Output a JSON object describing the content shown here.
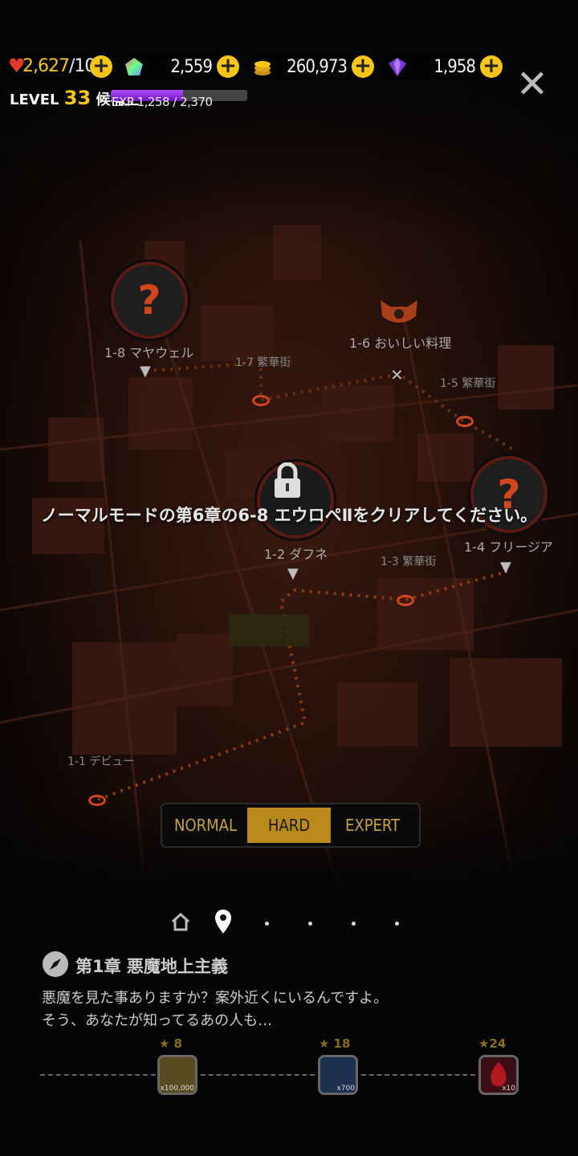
{
  "resources": {
    "stamina": {
      "value": "2,627",
      "max": "/100",
      "icon": "heart-icon"
    },
    "gems": {
      "value": "2,559",
      "icon": "rainbow-gem-icon"
    },
    "coins": {
      "value": "260,973",
      "icon": "coin-stack-icon"
    },
    "crystals": {
      "value": "1,958",
      "icon": "purple-crystal-icon"
    }
  },
  "player": {
    "level_label": "LEVEL",
    "level": "33",
    "rank": "候補生",
    "exp_text": "EXP 1,258 / 2,370",
    "exp_fraction": 0.53
  },
  "map": {
    "stages": [
      {
        "label": "1-8 マヤウェル"
      },
      {
        "label": "1-7 繁華街"
      },
      {
        "label": "1-6 おいしい料理"
      },
      {
        "label": "1-5 繁華街"
      },
      {
        "label": "1-4 フリージア"
      },
      {
        "label": "1-3 繁華街"
      },
      {
        "label": "1-2 ダフネ"
      },
      {
        "label": "1-1 デビュー"
      }
    ],
    "message": "ノーマルモードの第6章の6-8 エウロペⅡをクリアしてください。",
    "unknown_glyph": "?"
  },
  "difficulty": {
    "normal": "NORMAL",
    "hard": "HARD",
    "expert": "EXPERT",
    "selected": "HARD"
  },
  "chapter": {
    "title": "第1章 悪魔地上主義",
    "line1": "悪魔を見た事ありますか？案外近くにいるんですよ。",
    "line2": "そう、あなたが知ってるあの人も…"
  },
  "rewards": [
    {
      "stars": "8",
      "qty": "x100,000"
    },
    {
      "stars": "18",
      "qty": "x700"
    },
    {
      "stars": "24",
      "qty": "x10"
    }
  ],
  "colors": {
    "accent": "#f5c518",
    "hard": "#b98a1a",
    "node_red": "#d2461e"
  }
}
